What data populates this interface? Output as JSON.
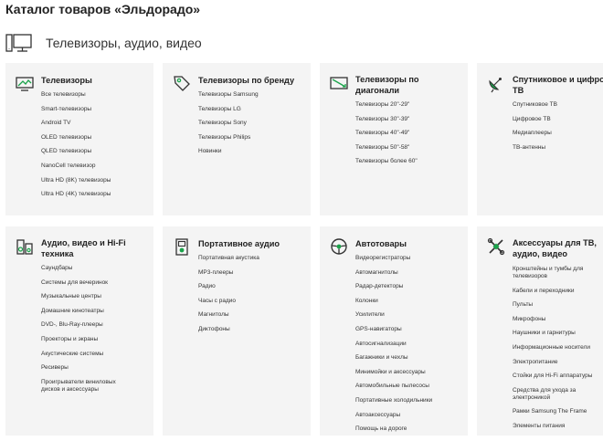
{
  "page_title": "Каталог товаров «Эльдорадо»",
  "section": {
    "title": "Телевизоры, аудио, видео",
    "icon": "tv-monitor-icon"
  },
  "categories": [
    {
      "title": "Телевизоры",
      "icon": "tv-icon",
      "links": [
        "Все телевизоры",
        "Smart-телевизоры",
        "Android TV",
        "OLED телевизоры",
        "QLED телевизоры",
        "NanoCell телевизор",
        "Ultra HD (8K) телевизоры",
        "Ultra HD (4K) телевизоры"
      ]
    },
    {
      "title": "Телевизоры по бренду",
      "icon": "tag-icon",
      "links": [
        "Телевизоры Samsung",
        "Телевизоры LG",
        "Телевизоры Sony",
        "Телевизоры Philips",
        "Новинки"
      ]
    },
    {
      "title": "Телевизоры по диагонали",
      "icon": "diagonal-screen-icon",
      "links": [
        "Телевизоры 20\"-29\"",
        "Телевизоры 30\"-39\"",
        "Телевизоры 40\"-49\"",
        "Телевизоры 50\"-58\"",
        "Телевизоры более 60\""
      ]
    },
    {
      "title": "Спутниковое и цифровое ТВ",
      "icon": "satellite-dish-icon",
      "links": [
        "Спутниковое ТВ",
        "Цифровое ТВ",
        "Медиаплееры",
        "ТВ-антенны"
      ]
    },
    {
      "title": "Аудио, видео и Hi-Fi техника",
      "icon": "speakers-icon",
      "links": [
        "Саундбары",
        "Системы для вечеринок",
        "Музыкальные центры",
        "Домашние кинотеатры",
        "DVD-, Blu-Ray-плееры",
        "Проекторы и экраны",
        "Акустические системы",
        "Ресиверы",
        "Проигрыватели виниловых дисков и аксессуары"
      ]
    },
    {
      "title": "Портативное аудио",
      "icon": "portable-player-icon",
      "links": [
        "Портативная акустика",
        "MP3-плееры",
        "Радио",
        "Часы с радио",
        "Магнитолы",
        "Диктофоны"
      ]
    },
    {
      "title": "Автотовары",
      "icon": "steering-wheel-icon",
      "links": [
        "Видеорегистраторы",
        "Автомагнитолы",
        "Радар-детекторы",
        "Колонки",
        "Усилители",
        "GPS-навигаторы",
        "Автосигнализации",
        "Багажники и чехлы",
        "Минимойки и аксессуары",
        "Автомобильные пылесосы",
        "Портативные холодильники",
        "Автоаксессуары",
        "Помощь на дороге"
      ]
    },
    {
      "title": "Аксессуары для ТВ, аудио, видео",
      "icon": "tools-cross-icon",
      "links": [
        "Кронштейны и тумбы для телевизоров",
        "Кабели и переходники",
        "Пульты",
        "Микрофоны",
        "Наушники и гарнитуры",
        "Информационные носители",
        "Электропитание",
        "Стойки для Hi-Fi аппаратуры",
        "Средства для ухода за электроникой",
        "Рамки Samsung The Frame",
        "Элементы питания"
      ]
    }
  ]
}
